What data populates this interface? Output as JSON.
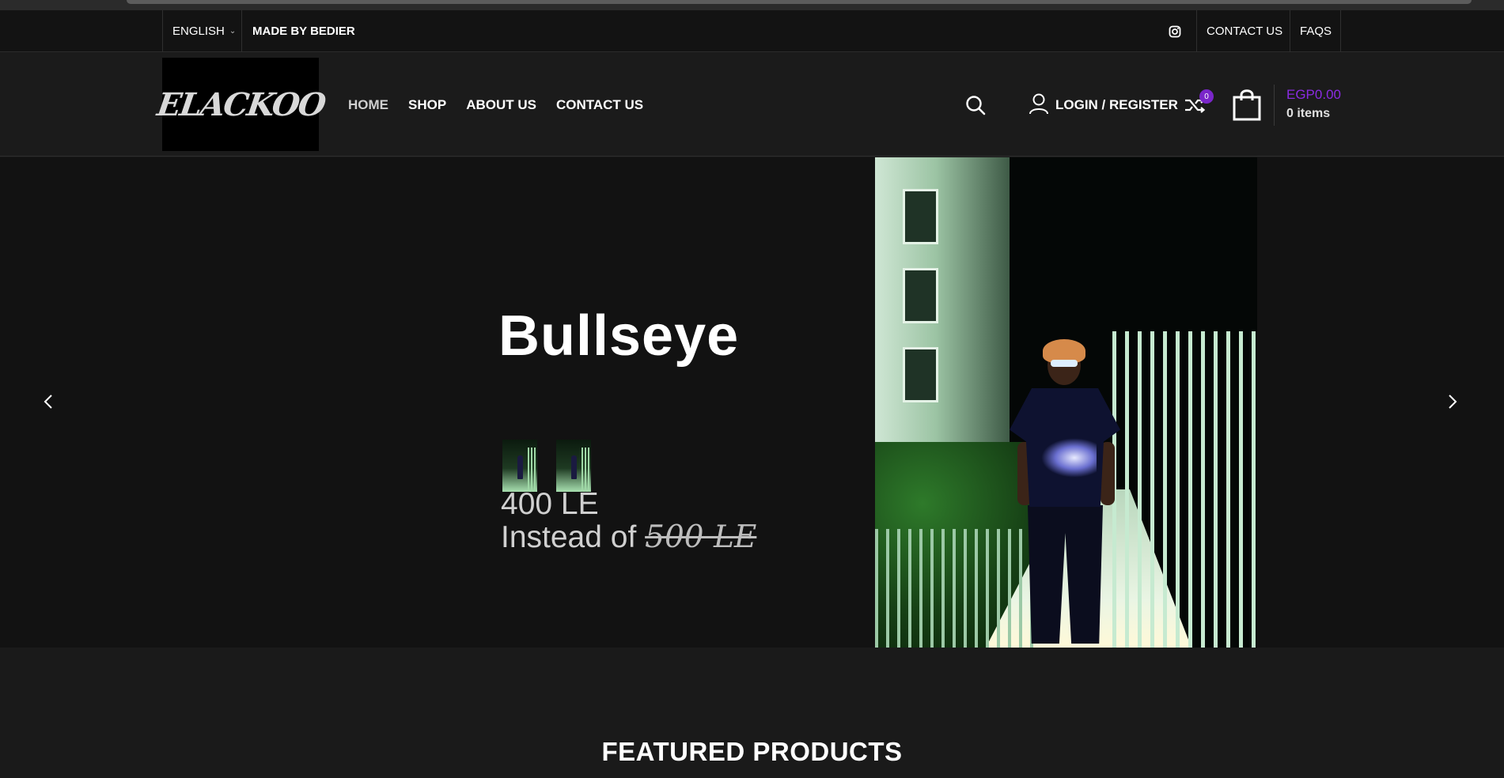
{
  "topbar": {
    "language": "ENGLISH",
    "made_by": "MADE BY BEDIER",
    "contact": "CONTACT US",
    "faqs": "FAQS"
  },
  "header": {
    "logo_text": "ELACKOO",
    "nav": [
      "HOME",
      "SHOP",
      "ABOUT US",
      "CONTACT US"
    ],
    "login": "LOGIN / REGISTER",
    "compare_count": "0",
    "cart_amount": "EGP0.00",
    "cart_items": "0 items"
  },
  "hero": {
    "title": "Bullseye",
    "price": "400 LE",
    "instead_of": "Instead of",
    "old_price": "500 LE"
  },
  "featured": {
    "heading": "FEATURED PRODUCTS"
  },
  "colors": {
    "accent": "#7a26c9",
    "cart_amount": "#8a2be2",
    "background": "#121212"
  },
  "icons": [
    "chevron-down-icon",
    "instagram-icon",
    "search-icon",
    "user-icon",
    "shuffle-icon",
    "shopping-bag-icon",
    "chevron-left-icon",
    "chevron-right-icon"
  ]
}
